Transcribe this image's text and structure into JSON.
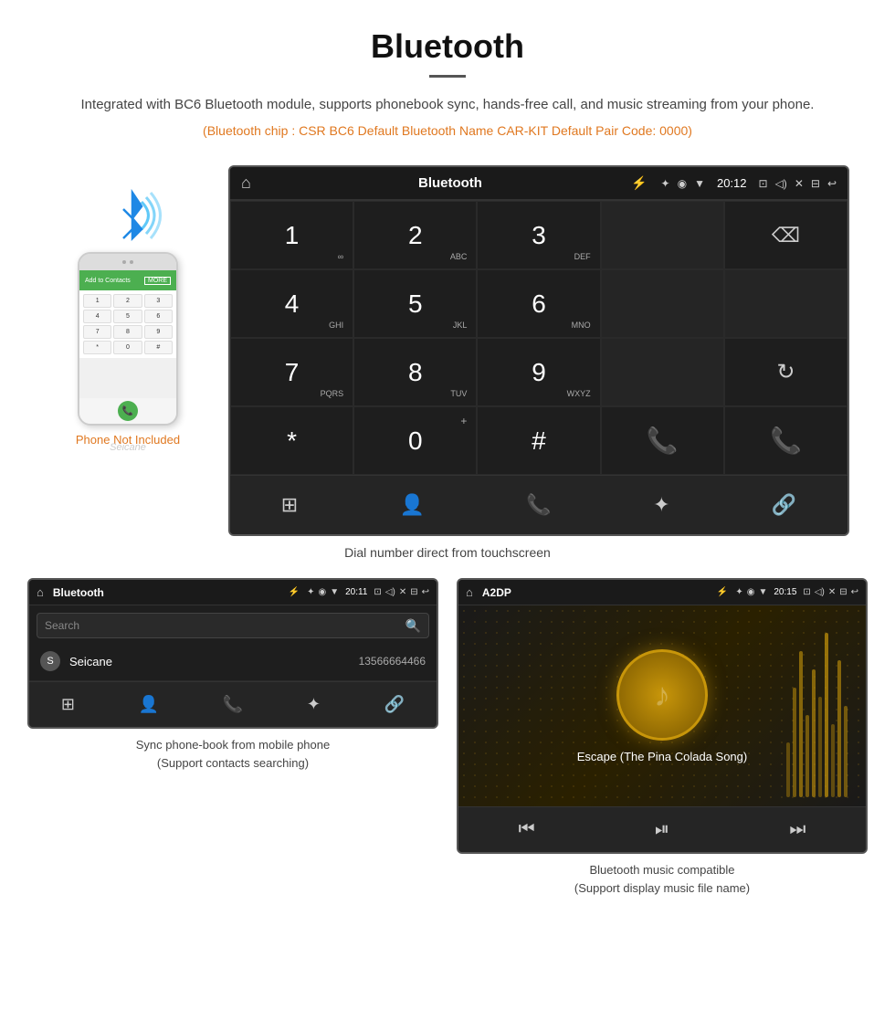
{
  "header": {
    "title": "Bluetooth",
    "description": "Integrated with BC6 Bluetooth module, supports phonebook sync, hands-free call, and music streaming from your phone.",
    "specs": "(Bluetooth chip : CSR BC6    Default Bluetooth Name CAR-KIT    Default Pair Code: 0000)"
  },
  "phone_label": "Phone Not Included",
  "seicane_watermark": "Seicane",
  "dialpad_screen": {
    "title": "Bluetooth",
    "keys": [
      {
        "num": "1",
        "letters": "∞",
        "row": 1,
        "col": 1
      },
      {
        "num": "2",
        "letters": "ABC",
        "row": 1,
        "col": 2
      },
      {
        "num": "3",
        "letters": "DEF",
        "row": 1,
        "col": 3
      },
      {
        "num": "4",
        "letters": "GHI",
        "row": 2,
        "col": 1
      },
      {
        "num": "5",
        "letters": "JKL",
        "row": 2,
        "col": 2
      },
      {
        "num": "6",
        "letters": "MNO",
        "row": 2,
        "col": 3
      },
      {
        "num": "7",
        "letters": "PQRS",
        "row": 3,
        "col": 1
      },
      {
        "num": "8",
        "letters": "TUV",
        "row": 3,
        "col": 2
      },
      {
        "num": "9",
        "letters": "WXYZ",
        "row": 3,
        "col": 3
      },
      {
        "num": "*",
        "letters": "",
        "row": 4,
        "col": 1
      },
      {
        "num": "0",
        "letters": "+",
        "row": 4,
        "col": 2
      },
      {
        "num": "#",
        "letters": "",
        "row": 4,
        "col": 3
      }
    ],
    "time": "20:12",
    "caption": "Dial number direct from touchscreen"
  },
  "phonebook_screen": {
    "title": "Bluetooth",
    "time": "20:11",
    "search_placeholder": "Search",
    "contacts": [
      {
        "letter": "S",
        "name": "Seicane",
        "number": "13566664466"
      }
    ],
    "caption": "Sync phone-book from mobile phone\n(Support contacts searching)"
  },
  "music_screen": {
    "title": "A2DP",
    "time": "20:15",
    "song_title": "Escape (The Pina Colada Song)",
    "note_icon": "♪",
    "caption": "Bluetooth music compatible\n(Support display music file name)"
  },
  "icons": {
    "home": "⌂",
    "back": "↩",
    "usb": "⚡",
    "bluetooth": "⚡",
    "location": "◉",
    "wifi": "▲",
    "battery": "▮",
    "camera": "⊡",
    "volume": "◁",
    "close_x": "✕",
    "window": "⊟",
    "backspace": "⌫",
    "reload": "↻",
    "call_green": "📞",
    "call_red": "📞",
    "dialpad_grid": "⊞",
    "person": "👤",
    "phone_icon": "📞",
    "bt_icon": "⚡",
    "link_icon": "🔗"
  }
}
